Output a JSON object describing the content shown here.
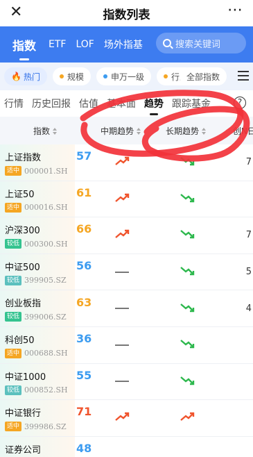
{
  "window": {
    "title": "指数列表"
  },
  "main_tabs": [
    {
      "label": "指数",
      "active": true
    },
    {
      "label": "ETF",
      "active": false
    },
    {
      "label": "LOF",
      "active": false
    },
    {
      "label": "场外指基",
      "active": false
    }
  ],
  "search": {
    "placeholder": "搜索关键词"
  },
  "chips": [
    {
      "label": "热门",
      "active": true,
      "dot_color": "#ff5a5a"
    },
    {
      "label": "规模",
      "active": false,
      "dot_color": "#f5a623"
    },
    {
      "label": "申万一级",
      "active": false,
      "dot_color": "#3d9cf0"
    },
    {
      "label": "行业",
      "active": false,
      "dot_color": "#f5a623"
    }
  ],
  "chips_all": "全部指数",
  "sub_tabs": [
    {
      "label": "行情",
      "active": false
    },
    {
      "label": "历史回报",
      "active": false
    },
    {
      "label": "估值",
      "active": false
    },
    {
      "label": "基本面",
      "active": false
    },
    {
      "label": "趋势",
      "active": true
    },
    {
      "label": "跟踪基金",
      "active": false
    }
  ],
  "help_label": "?",
  "table_header": {
    "name": "指数",
    "mid_trend": "中期趋势",
    "long_trend": "长期趋势",
    "new": "创N日"
  },
  "colors": {
    "up": "#f0542d",
    "down": "#2db84d",
    "flat": "#777777",
    "tag_mid": "#f5a623",
    "tag_low": "#34c38f",
    "tag_lower": "#5bc0be"
  },
  "rows": [
    {
      "name": "上证指数",
      "tag": "适中",
      "tag_color": "#f5a623",
      "code": "000001.SH",
      "score": "57",
      "score_color": "#3d9cf0",
      "mid": "up",
      "long": "down",
      "last": "7"
    },
    {
      "name": "上证50",
      "tag": "适中",
      "tag_color": "#f5a623",
      "code": "000016.SH",
      "score": "61",
      "score_color": "#f5a623",
      "mid": "up",
      "long": "down",
      "last": ""
    },
    {
      "name": "沪深300",
      "tag": "较低",
      "tag_color": "#34c38f",
      "code": "000300.SH",
      "score": "66",
      "score_color": "#f5a623",
      "mid": "up",
      "long": "down",
      "last": "7"
    },
    {
      "name": "中证500",
      "tag": "较低",
      "tag_color": "#5bc0be",
      "code": "399905.SZ",
      "score": "56",
      "score_color": "#3d9cf0",
      "mid": "flat",
      "long": "down",
      "last": "5"
    },
    {
      "name": "创业板指",
      "tag": "较低",
      "tag_color": "#34c38f",
      "code": "399006.SZ",
      "score": "63",
      "score_color": "#f5a623",
      "mid": "flat",
      "long": "down",
      "last": "4"
    },
    {
      "name": "科创50",
      "tag": "适中",
      "tag_color": "#f5a623",
      "code": "000688.SH",
      "score": "36",
      "score_color": "#3d9cf0",
      "mid": "flat",
      "long": "down",
      "last": ""
    },
    {
      "name": "中证1000",
      "tag": "较低",
      "tag_color": "#5bc0be",
      "code": "000852.SH",
      "score": "55",
      "score_color": "#3d9cf0",
      "mid": "flat",
      "long": "down",
      "last": ""
    },
    {
      "name": "中证银行",
      "tag": "适中",
      "tag_color": "#f5a623",
      "code": "399986.SZ",
      "score": "71",
      "score_color": "#f0542d",
      "mid": "up",
      "long": "up",
      "last": ""
    },
    {
      "name": "证券公司",
      "tag": "",
      "tag_color": "#f5a623",
      "code": "",
      "score": "48",
      "score_color": "#3d9cf0",
      "mid": "",
      "long": "",
      "last": ""
    }
  ]
}
